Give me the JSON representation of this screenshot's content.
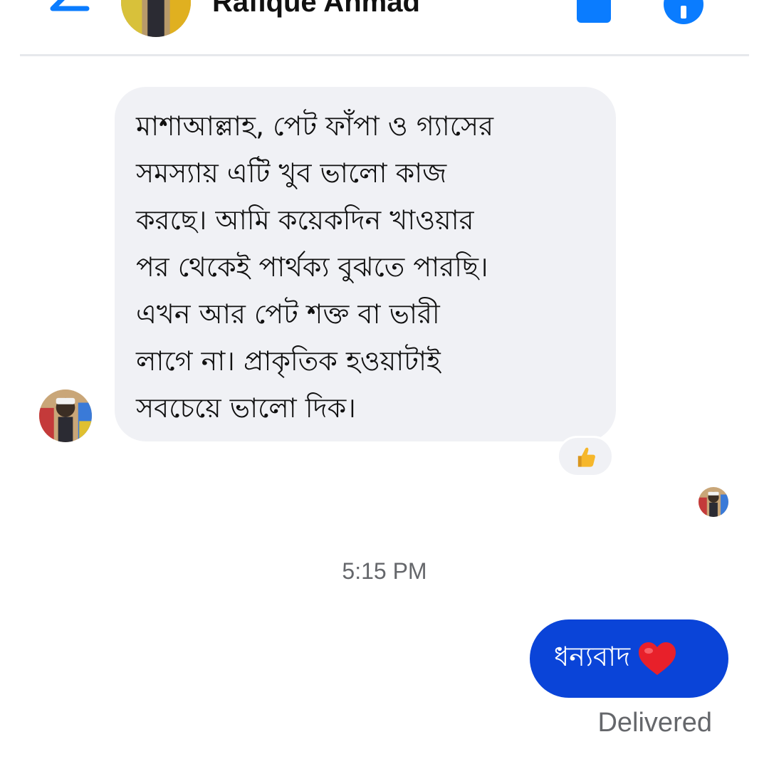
{
  "header": {
    "contact_name": "Rafique Ahmad",
    "back_icon": "arrow-left-icon",
    "call_icon": "phone-icon",
    "info_icon": "info-icon",
    "accent_color": "#0a7cff"
  },
  "messages": {
    "incoming": {
      "lines": [
        "মাশাআল্লাহ, পেট ফাঁপা ও গ্যাসের",
        "সমস্যায় এটি খুব ভালো কাজ",
        "করছে। আমি কয়েকদিন খাওয়ার",
        "পর থেকেই পার্থক্য বুঝতে পারছি।",
        "এখন আর পেট শক্ত বা ভারী",
        "লাগে না। প্রাকৃতিক হওয়াটাই",
        "সবচেয়ে ভালো দিক।"
      ],
      "reaction": "👍",
      "bubble_color": "#f0f1f5"
    },
    "timestamp": "5:15 PM",
    "outgoing": {
      "text": "ধন্যবাদ",
      "emoji": "❤️",
      "bubble_color": "#0a44d8"
    },
    "status": "Delivered"
  }
}
